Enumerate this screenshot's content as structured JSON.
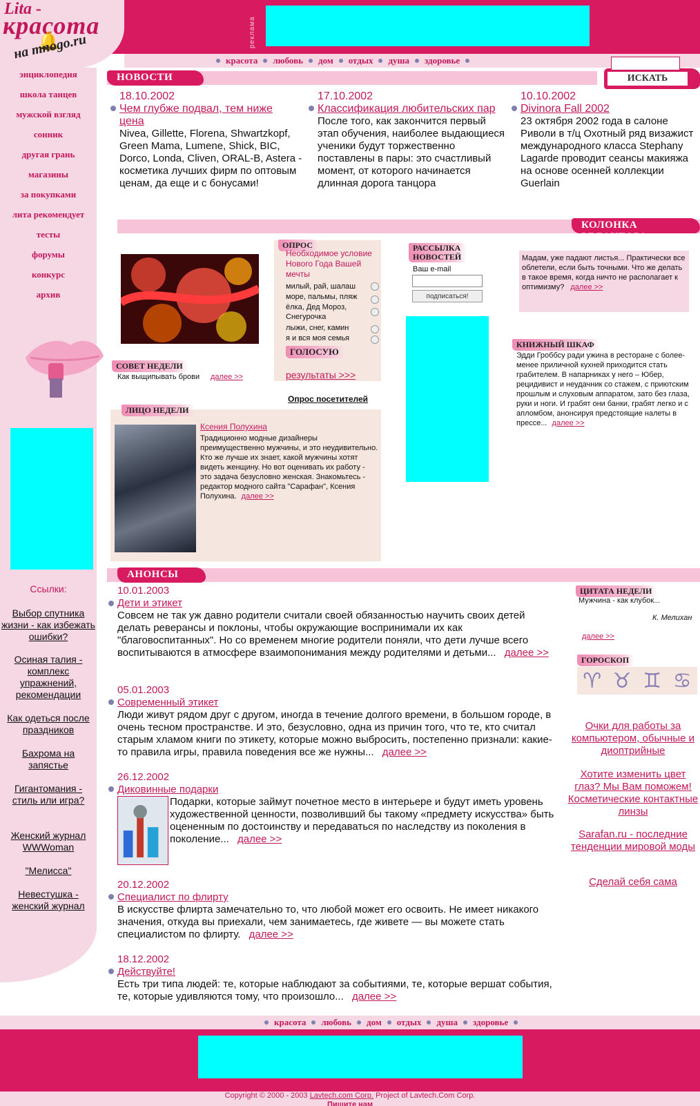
{
  "brand": {
    "lita": "Lita -",
    "krasota": "красота",
    "mnogo": "на mnogo.ru"
  },
  "ads": {
    "label": "реклама"
  },
  "nav": [
    "красота",
    "любовь",
    "дом",
    "отдых",
    "душа",
    "здоровье"
  ],
  "search": {
    "button": "ИСКАТЬ",
    "placeholder": ""
  },
  "sidebar": {
    "items": [
      "энциклопедия",
      "школа танцев",
      "мужской взгляд",
      "сонник",
      "другая грань",
      "магазины",
      "за покупками",
      "лита рекомендует",
      "тесты",
      "форумы",
      "конкурс",
      "архив"
    ],
    "links_title": "Ссылки:",
    "links": [
      "Выбор спутника жизни - как избежать ошибки?",
      "Осиная талия - комплекс упражнений, рекомендации",
      "Как одеться после праздников",
      "Бахрома на запястье",
      "Гигантомания - стиль или игра?",
      "Женский журнал WWWoman",
      "\"Мелисса\"",
      "Невестушка - женский журнал"
    ]
  },
  "news": {
    "header": "НОВОСТИ",
    "items": [
      {
        "date": "18.10.2002",
        "title": "Чем глубже подвал, тем ниже цена",
        "text": "Nivea, Gillette, Florena, Shwartzkopf, Green Mama, Lumene, Shick, BIC, Dorco, Londa, Cliven, ORAL-B, Astera - косметика лучших фирм по оптовым ценам, да еще и с бонусами!"
      },
      {
        "date": "17.10.2002",
        "title": "Классификация любительских пар",
        "text": "После того, как закончится первый этап обучения, наиболее выдающиеся ученики будут торжественно поставлены в пары: это счастливый момент, от которого начинается длинная дорога танцора"
      },
      {
        "date": "10.10.2002",
        "title": "Divinora Fall 2002",
        "text": "23 октября 2002 года в салоне Риволи в т/ц Охотный ряд визажист международного класса Stephany Lagarde проводит сеансы макияжа на основе осенней коллекции Guerlain"
      }
    ]
  },
  "editor": {
    "header": "КОЛОНКА РЕДАКТОРА",
    "text": "Мадам, уже падают листья... Практически все облетели, если быть точными. Что же делать в такое время, когда ничто не располагает к оптимизму?",
    "more": "далее >>"
  },
  "poll": {
    "header": "ОПРОС",
    "question": "Необходимое условие Нового Года Вашей мечты",
    "options": [
      "милый, рай, шалаш",
      "море, пальмы, пляж",
      "ёлка, Дед Мороз, Снегурочка",
      "лыжи, снег, камин",
      "я и вся моя семья"
    ],
    "vote": "ГОЛОСУЮ",
    "results": "результаты >>>",
    "visitors": "Опрос посетителей"
  },
  "newsletter": {
    "header_line1": "РАССЫЛКА",
    "header_line2": "НОВОСТЕЙ",
    "label": "Ваш e-mail",
    "button": "подписаться!"
  },
  "tip": {
    "header": "СОВЕТ НЕДЕЛИ",
    "text": "Как выщипывать брови",
    "more": "далее >>"
  },
  "face": {
    "header": "ЛИЦО НЕДЕЛИ",
    "name": "Ксения Полухина",
    "text": "Традиционно модные дизайнеры преимущественно мужчины, и это неудивительно. Кто же лучше их знает, какой мужчины хотят видеть женщину. Но вот оценивать их работу - это задача безусловно женская. Знакомьтесь - редактор модного сайта \"Сарафан\", Ксения Полухина.",
    "more": "далее >>"
  },
  "books": {
    "header": "КНИЖНЫЙ ШКАФ",
    "text": "Эдди Гроббсу ради ужина в ресторане с более-менее приличной кухней приходится стать грабителем. В напарниках у него – Юбер, рецидивист и неудачник со стажем, с приютским прошлым и слуховым аппаратом, зато без глаза, руки и ноги. И грабят они банки, грабят легко и с апломбом, анонсируя предстоящие налеты в прессе...",
    "more": "далее >>"
  },
  "anons": {
    "header": "АНОНСЫ",
    "items": [
      {
        "date": "10.01.2003",
        "title": "Дети и этикет",
        "text": "Совсем не так уж давно родители считали своей обязанностью научить своих детей делать реверансы и поклоны, чтобы окружающие воспринимали их как \"благовоспитанных\". Но со временем многие родители поняли, что дети лучше всего воспитываются в атмосфере взаимопонимания между родителями и детьми...",
        "more": "далее >>"
      },
      {
        "date": "05.01.2003",
        "title": "Современный этикет",
        "text": "Люди живут рядом друг с другом, иногда в течение долгого времени, в большом городе, в очень тесном пространстве. И это, безусловно, одна из причин того, что те, кто считал старым хламом книги по этикету, которые можно выбросить, постепенно признали: какие-то правила игры, правила поведения все же нужны...",
        "more": "далее >>"
      },
      {
        "date": "26.12.2002",
        "title": "Диковинные подарки",
        "text": "Подарки, которые займут почетное место в интерьере и будут иметь уровень художественной ценности, позволивший бы такому «предмету искусства» быть оцененным по достоинству и передаваться по наследству из поколения в поколение...",
        "more": "далее >>"
      },
      {
        "date": "20.12.2002",
        "title": "Специалист по флирту",
        "text": "В искусстве флирта замечательно то, что любой может его освоить. Не имеет никакого значения, откуда вы приехали, чем занимаетесь, где живете — вы можете стать специалистом по флирту.",
        "more": "далее >>"
      },
      {
        "date": "18.12.2002",
        "title": "Действуйте!",
        "text": "Есть три типа людей: те, которые наблюдают за событиями, те, которые вершат события, те, которые удивляются тому, что произошло...",
        "more": "далее >>"
      }
    ]
  },
  "quote": {
    "header": "ЦИТАТА НЕДЕЛИ",
    "text": "Мужчина - как клубок...",
    "author": "К. Мелихан",
    "more": "далее >>"
  },
  "horoscope": {
    "header": "ГОРОСКОП",
    "signs": [
      "♈",
      "♉",
      "♊",
      "♋"
    ]
  },
  "right_links": [
    "Очки для работы за компьютером, обычные и диоптрийные",
    "Хотите изменить цвет глаз? Мы Вам поможем! Косметические контактные линзы",
    "Sarafan.ru - последние тенденции мировой моды",
    "Сделай себя сама"
  ],
  "footer": {
    "copy_prefix": "Copyright © 2000 - 2003",
    "copy_link": "Lavtech.com Corp.",
    "copy_suffix": "Project of Lavtech.Com Corp.",
    "write": "Пишите нам"
  },
  "colors": {
    "brand": "#d81b60",
    "pink_light": "#f6d7e4",
    "link": "#c2185b",
    "ad": "#00ffff"
  }
}
